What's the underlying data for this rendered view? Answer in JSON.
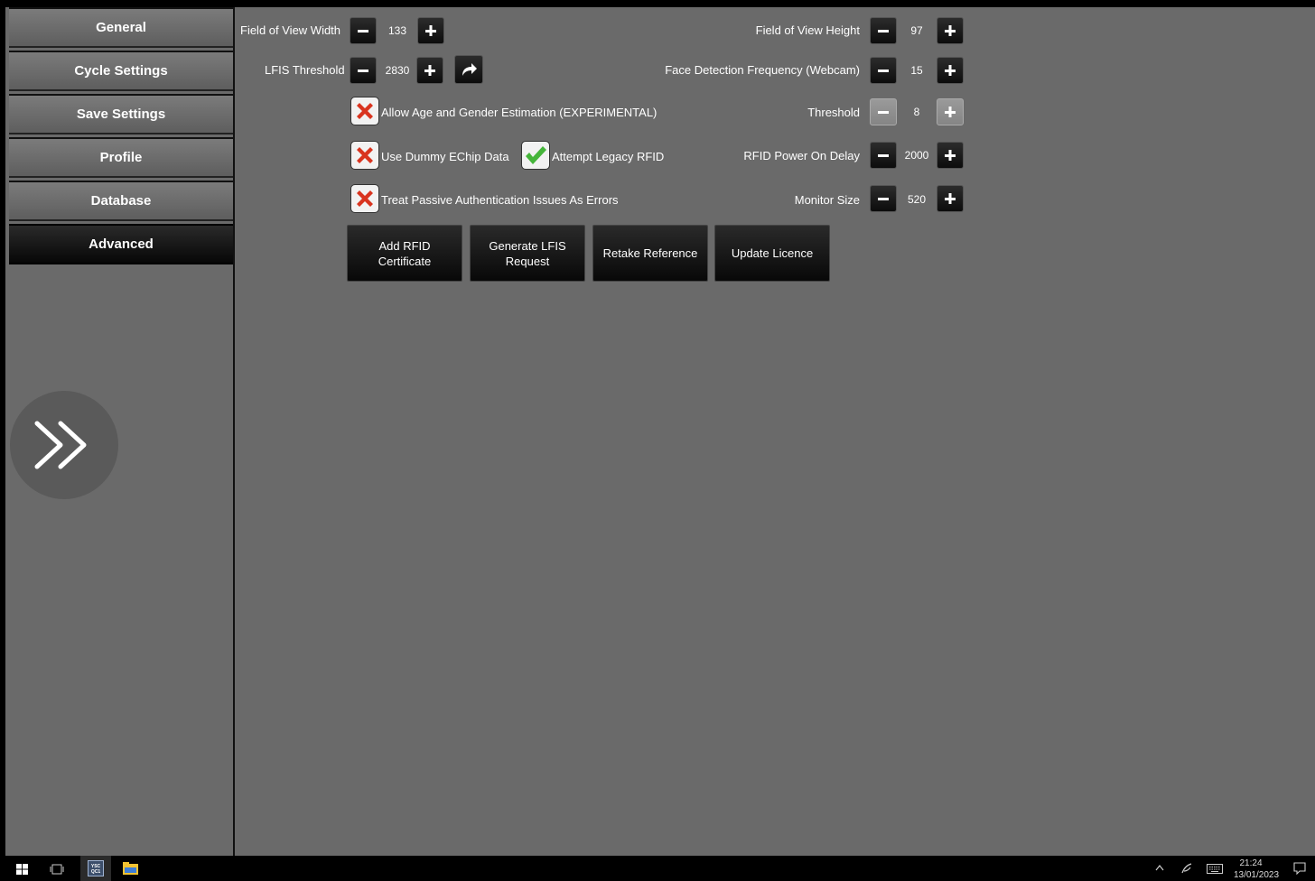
{
  "sidebar": {
    "items": [
      {
        "label": "General",
        "active": false
      },
      {
        "label": "Cycle Settings",
        "active": false
      },
      {
        "label": "Save Settings",
        "active": false
      },
      {
        "label": "Profile",
        "active": false
      },
      {
        "label": "Database",
        "active": false
      },
      {
        "label": "Advanced",
        "active": true
      }
    ],
    "expand_icon": "double-chevron-right-icon"
  },
  "settings": {
    "fov_width": {
      "label": "Field of View Width",
      "value": "133"
    },
    "fov_height": {
      "label": "Field of View Height",
      "value": "97"
    },
    "lfis_threshold": {
      "label": "LFIS Threshold",
      "value": "2830"
    },
    "face_detection_frequency": {
      "label": "Face Detection Frequency (Webcam)",
      "value": "15"
    },
    "threshold": {
      "label": "Threshold",
      "value": "8",
      "disabled": true
    },
    "rfid_power_on_delay": {
      "label": "RFID Power On Delay",
      "value": "2000"
    },
    "monitor_size": {
      "label": "Monitor Size",
      "value": "520"
    }
  },
  "checkboxes": {
    "age_gender": {
      "label": "Allow Age and Gender Estimation (EXPERIMENTAL)",
      "checked": false
    },
    "dummy_echip": {
      "label": "Use Dummy EChip Data",
      "checked": false
    },
    "legacy_rfid": {
      "label": "Attempt Legacy RFID",
      "checked": true
    },
    "passive_auth": {
      "label": "Treat Passive Authentication Issues As Errors",
      "checked": false
    }
  },
  "actions": {
    "add_rfid_certificate": "Add RFID Certificate",
    "generate_lfis_request": "Generate LFIS Request",
    "retake_reference": "Retake Reference",
    "update_licence": "Update Licence"
  },
  "taskbar": {
    "time": "21:24",
    "date": "13/01/2023",
    "app_badge": "YSC\nQC1"
  },
  "colors": {
    "background": "#6a6a6a",
    "button_dark": "#0c0c0c",
    "check_red": "#d9341f",
    "check_green": "#45b53a"
  }
}
